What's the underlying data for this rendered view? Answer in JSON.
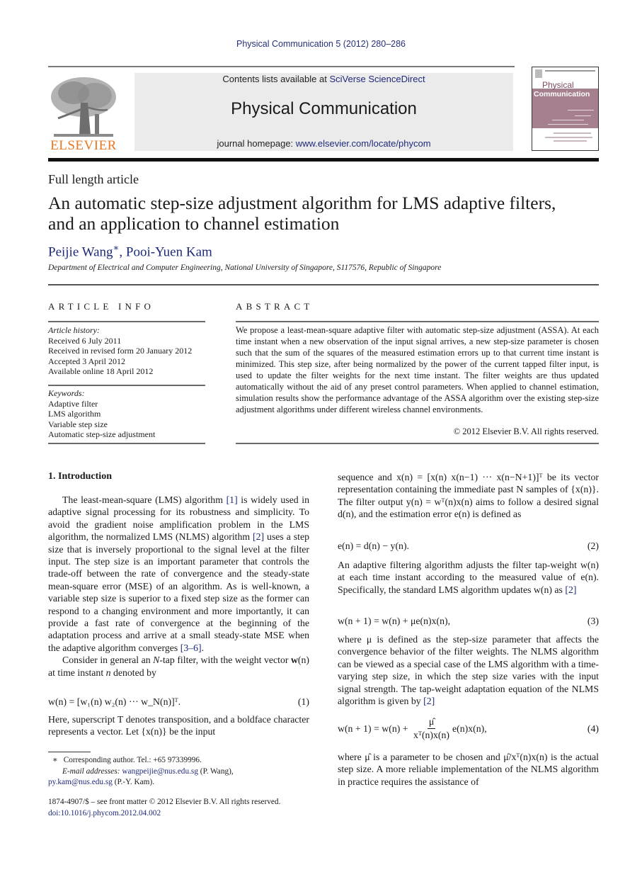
{
  "header": {
    "running_head": "Physical Communication 5 (2012) 280–286",
    "contents_prefix": "Contents lists available at ",
    "contents_link": "SciVerse ScienceDirect",
    "journal_title": "Physical Communication",
    "homepage_prefix": "journal homepage: ",
    "homepage_link": "www.elsevier.com/locate/phycom",
    "publisher_logo_text": "ELSEVIER",
    "cover_title_1": "Physical",
    "cover_title_2": "Communication",
    "colors": {
      "link": "#1e2a7a",
      "elsevier_orange": "#e87722",
      "cover_band": "#a6808f"
    }
  },
  "article": {
    "type": "Full length article",
    "title_line1": "An automatic step-size adjustment algorithm for LMS adaptive filters,",
    "title_line2": "and an application to channel estimation",
    "authors": [
      {
        "name": "Peijie Wang",
        "mark": "∗"
      },
      {
        "name": "Pooi-Yuen Kam",
        "mark": ""
      }
    ],
    "author_sep": ", ",
    "affiliation": "Department of Electrical and Computer Engineering, National University of Singapore, S117576, Republic of Singapore"
  },
  "article_info": {
    "heading": "ARTICLE INFO",
    "history_label": "Article history:",
    "history": [
      "Received 6 July 2011",
      "Received in revised form 20 January 2012",
      "Accepted 3 April 2012",
      "Available online 18 April 2012"
    ],
    "keywords_label": "Keywords:",
    "keywords": [
      "Adaptive filter",
      "LMS algorithm",
      "Variable step size",
      "Automatic step-size adjustment"
    ]
  },
  "abstract": {
    "heading": "ABSTRACT",
    "text": "We propose a least-mean-square adaptive filter with automatic step-size adjustment (ASSA). At each time instant when a new observation of the input signal arrives, a new step-size parameter is chosen such that the sum of the squares of the measured estimation errors up to that current time instant is minimized. This step size, after being normalized by the power of the current tapped filter input, is used to update the filter weights for the next time instant. The filter weights are thus updated automatically without the aid of any preset control parameters. When applied to channel estimation, simulation results show the performance advantage of the ASSA algorithm over the existing step-size adjustment algorithms under different wireless channel environments.",
    "copyright": "© 2012 Elsevier B.V. All rights reserved."
  },
  "body": {
    "section1_heading": "1.  Introduction",
    "left": {
      "p1_a": "The least-mean-square (LMS) algorithm ",
      "ref1": "[1]",
      "p1_b": " is widely used in adaptive signal processing for its robustness and simplicity. To avoid the gradient noise amplification problem in the LMS algorithm, the normalized LMS (NLMS) algorithm ",
      "ref2": "[2]",
      "p1_c": " uses a step size that is inversely proportional to the signal level at the filter input. The step size is an important parameter that controls the trade-off between the rate of convergence and the steady-state mean-square error (MSE) of an algorithm. As is well-known, a variable step size is superior to a fixed step size as the former can respond to a changing environment and more importantly, it can provide a fast rate of convergence at the beginning of the adaptation process and arrive at a small steady-state MSE when the adaptive algorithm converges ",
      "ref3": "[3–6]",
      "p1_d": ".",
      "p2_a": "Consider in general an ",
      "p2_N": "N",
      "p2_b": "-tap filter, with the weight vector ",
      "p2_w": "w",
      "p2_c": "(n) at time instant ",
      "p2_n": "n",
      "p2_d": " denoted by",
      "eq1": "w(n) = [w₁(n) w₂(n)  ···  w_N(n)]ᵀ.",
      "eq1_num": "(1)",
      "p3": "Here, superscript T denotes transposition, and a boldface character represents a vector. Let {x(n)} be the input"
    },
    "right": {
      "p1": "sequence and x(n) = [x(n) x(n−1)  ···  x(n−N+1)]ᵀ be its vector representation containing the immediate past N samples of {x(n)}. The filter output y(n) = wᵀ(n)x(n) aims to follow a desired signal d(n), and the estimation error e(n) is defined as",
      "eq2": "e(n) = d(n) − y(n).",
      "eq2_num": "(2)",
      "p2_a": "An adaptive filtering algorithm adjusts the filter tap-weight w(n) at each time instant according to the measured value of e(n). Specifically, the standard LMS algorithm updates w(n) as ",
      "p2_ref": "[2]",
      "eq3": "w(n + 1) = w(n) + μe(n)x(n),",
      "eq3_num": "(3)",
      "p3_a": "where μ is defined as the step-size parameter that affects the convergence behavior of the filter weights. The NLMS algorithm can be viewed as a special case of the LMS algorithm with a time-varying step size, in which the step size varies with the input signal strength. The tap-weight adaptation equation of the NLMS algorithm is given by ",
      "p3_ref": "[2]",
      "eq4_lhs": "w(n + 1) = w(n) + ",
      "eq4_num_top": "μ̂",
      "eq4_den": "xᵀ(n)x(n)",
      "eq4_rhs": "e(n)x(n),",
      "eq4_num": "(4)",
      "p4": "where μ̂ is a parameter to be chosen  and μ̂/xᵀ(n)x(n) is the actual step size. A more reliable implementation of the NLMS algorithm in practice requires the assistance of"
    }
  },
  "footnotes": {
    "star": "∗",
    "corresponding": "Corresponding author. Tel.: +65 97339996.",
    "email_label": "E-mail addresses:",
    "email1": "wangpeijie@nus.edu.sg",
    "email1_who": " (P. Wang),",
    "email2": "py.kam@nus.edu.sg",
    "email2_who": " (P.-Y. Kam).",
    "front_matter": "1874-4907/$ – see front matter © 2012 Elsevier B.V. All rights reserved.",
    "doi": "doi:10.1016/j.phycom.2012.04.002"
  }
}
